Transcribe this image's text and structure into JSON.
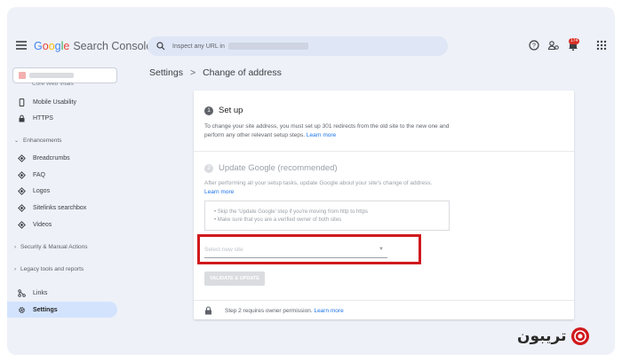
{
  "header": {
    "app_title": "Google Search Console",
    "search_placeholder": "Inspect any URL in",
    "notification_count": "174"
  },
  "sidebar": {
    "clipped_item": "Core Web Vitals",
    "items_top": [
      {
        "label": "Mobile Usability",
        "icon": "phone-icon"
      },
      {
        "label": "HTTPS",
        "icon": "lock-icon"
      }
    ],
    "enhancements_label": "Enhancements",
    "enhancements": [
      {
        "label": "Breadcrumbs",
        "icon": "diamond-icon"
      },
      {
        "label": "FAQ",
        "icon": "diamond-icon"
      },
      {
        "label": "Logos",
        "icon": "diamond-icon"
      },
      {
        "label": "Sitelinks searchbox",
        "icon": "diamond-icon"
      },
      {
        "label": "Videos",
        "icon": "diamond-icon"
      }
    ],
    "security_label": "Security & Manual Actions",
    "legacy_label": "Legacy tools and reports",
    "links_label": "Links",
    "settings_label": "Settings"
  },
  "breadcrumb": {
    "parent": "Settings",
    "separator": ">",
    "current": "Change of address"
  },
  "card": {
    "step1": {
      "number": "1",
      "title": "Set up",
      "text": "To change your site address, you must set up 301 redirects from the old site to the new one and perform any other relevant setup steps.",
      "link": "Learn more"
    },
    "step2": {
      "number": "2",
      "title": "Update Google (recommended)",
      "text": "After performing all your setup tasks, update Google about your site's change of address.",
      "link": "Learn more",
      "tip1": "• Skip the 'Update Google' step if you're moving from http to https",
      "tip2": "• Make sure that you are a verified owner of both sites",
      "select_placeholder": "Select new site",
      "validate_button": "VALIDATE & UPDATE"
    },
    "footer": {
      "text": "Step 2 requires owner permission.",
      "link": "Learn more"
    }
  },
  "colors": {
    "accent": "#1a73e8",
    "highlight_box": "#d0191d",
    "active_nav": "#d3e3fd"
  }
}
